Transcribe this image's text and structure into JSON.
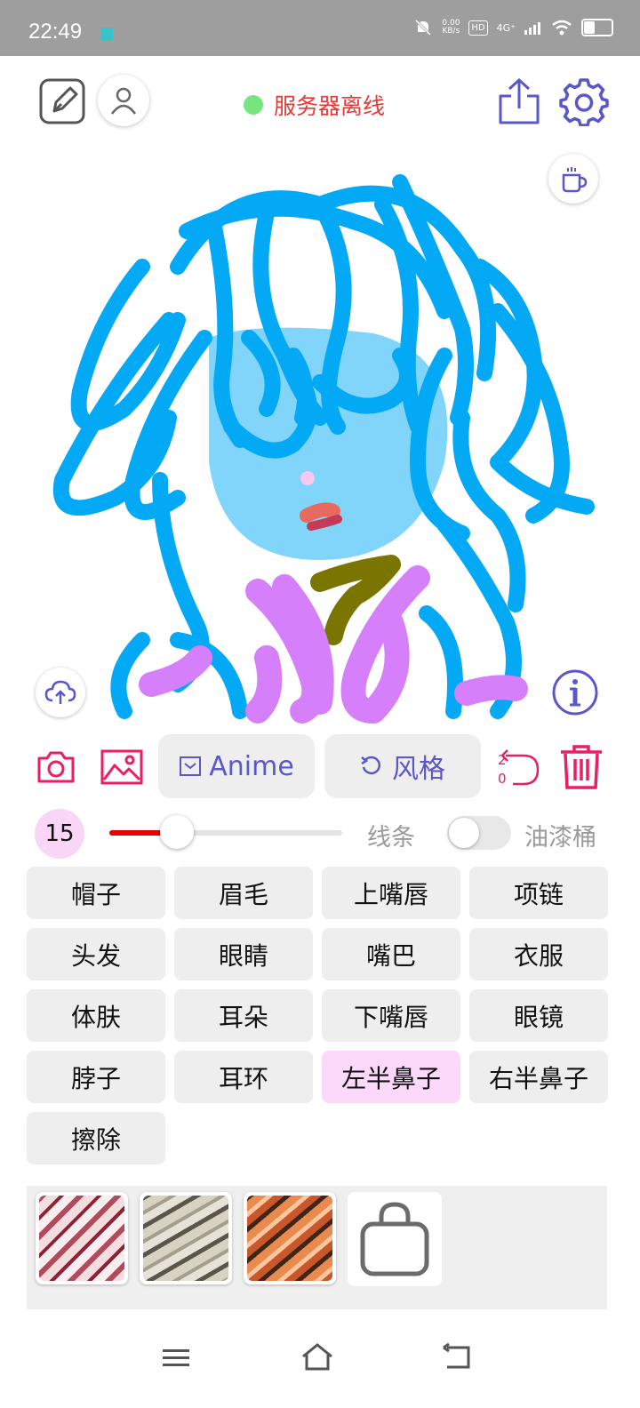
{
  "statusbar": {
    "time": "22:49",
    "speed_value": "0.00",
    "speed_unit": "KB/s",
    "hd": "HD",
    "network": "4G⁺"
  },
  "header": {
    "server_status": "服务器离线",
    "status_color": "#76e57d"
  },
  "canvas": {
    "colors": {
      "hair": "#03a9f4",
      "skin": "#81d4fa",
      "clothes": "#d580fa",
      "collar": "#7a7400",
      "mouth": "#e86a5f",
      "nose": "#f7c8f2"
    }
  },
  "tools": {
    "model_label": "Anime",
    "style_label": "风格",
    "undo_count_top": "2",
    "undo_count_bottom": "0"
  },
  "brush": {
    "size": "15",
    "slider_fraction": 0.29,
    "line_label": "线条",
    "bucket_label": "油漆桶",
    "bucket_enabled": false
  },
  "parts": [
    {
      "label": "帽子"
    },
    {
      "label": "眉毛"
    },
    {
      "label": "上嘴唇"
    },
    {
      "label": "项链"
    },
    {
      "label": "头发"
    },
    {
      "label": "眼睛"
    },
    {
      "label": "嘴巴"
    },
    {
      "label": "衣服"
    },
    {
      "label": "体肤"
    },
    {
      "label": "耳朵"
    },
    {
      "label": "下嘴唇"
    },
    {
      "label": "眼镜"
    },
    {
      "label": "脖子"
    },
    {
      "label": "耳环"
    },
    {
      "label": "左半鼻子"
    },
    {
      "label": "右半鼻子"
    },
    {
      "label": "擦除"
    }
  ],
  "selected_part": "左半鼻子",
  "accent_color": "#e91e63",
  "brand_color": "#5b57c8",
  "textures": [
    "red-marble-texture",
    "gray-marble-texture",
    "orange-marble-texture",
    "shop-bag-icon"
  ]
}
